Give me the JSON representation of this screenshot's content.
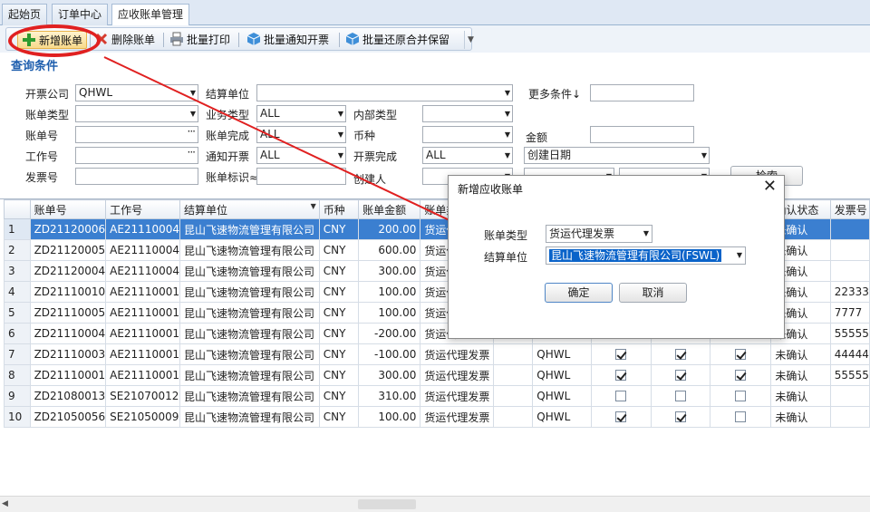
{
  "tabs": [
    {
      "label": "起始页"
    },
    {
      "label": "订单中心"
    },
    {
      "label": "应收账单管理"
    }
  ],
  "toolbar": {
    "new_bill": "新增账单",
    "delete_bill": "删除账单",
    "batch_print": "批量打印",
    "batch_notify_invoice": "批量通知开票",
    "batch_restore_merge": "批量还原合并保留"
  },
  "query": {
    "title": "查询条件",
    "invoice_company_label": "开票公司",
    "invoice_company_value": "QHWL",
    "settle_unit_label": "结算单位",
    "more_conditions_label": "更多条件↓",
    "bill_type_label": "账单类型",
    "business_type_label": "业务类型",
    "business_type_value": "ALL",
    "internal_type_label": "内部类型",
    "bill_no_label": "账单号",
    "bill_complete_label": "账单完成",
    "bill_complete_value": "ALL",
    "currency_label": "币种",
    "amount_label": "金额",
    "job_no_label": "工作号",
    "notify_invoice_label": "通知开票",
    "notify_invoice_value": "ALL",
    "invoice_complete_label": "开票完成",
    "invoice_complete_value": "ALL",
    "date_type_value": "创建日期",
    "invoice_no_label": "发票号",
    "bill_mark_label": "账单标识≈",
    "creator_label": "创建人",
    "search_button": "检索"
  },
  "grid": {
    "headers": [
      "",
      "账单号",
      "工作号",
      "结算单位",
      "币种",
      "账单金额",
      "账单类",
      "",
      "",
      "",
      "",
      "",
      "确认状态",
      "发票号"
    ],
    "rows": [
      {
        "n": "1",
        "bill": "ZD21120006",
        "job": "AE21110004",
        "unit": "昆山飞速物流管理有限公司",
        "cur": "CNY",
        "amt": "200.00",
        "type": "货运代",
        "co": "",
        "c1": null,
        "c2": null,
        "c3": null,
        "status": "未确认",
        "inv": ""
      },
      {
        "n": "2",
        "bill": "ZD21120005",
        "job": "AE21110004",
        "unit": "昆山飞速物流管理有限公司",
        "cur": "CNY",
        "amt": "600.00",
        "type": "货运代",
        "co": "",
        "c1": null,
        "c2": null,
        "c3": null,
        "status": "未确认",
        "inv": ""
      },
      {
        "n": "3",
        "bill": "ZD21120004",
        "job": "AE21110004",
        "unit": "昆山飞速物流管理有限公司",
        "cur": "CNY",
        "amt": "300.00",
        "type": "货运代",
        "co": "",
        "c1": null,
        "c2": null,
        "c3": null,
        "status": "未确认",
        "inv": ""
      },
      {
        "n": "4",
        "bill": "ZD21110010",
        "job": "AE21110001",
        "unit": "昆山飞速物流管理有限公司",
        "cur": "CNY",
        "amt": "100.00",
        "type": "货运代",
        "co": "",
        "c1": null,
        "c2": null,
        "c3": null,
        "status": "未确认",
        "inv": "22333"
      },
      {
        "n": "5",
        "bill": "ZD21110005",
        "job": "AE21110001",
        "unit": "昆山飞速物流管理有限公司",
        "cur": "CNY",
        "amt": "100.00",
        "type": "货运代",
        "co": "",
        "c1": null,
        "c2": null,
        "c3": null,
        "status": "未确认",
        "inv": "7777"
      },
      {
        "n": "6",
        "bill": "ZD21110004",
        "job": "AE21110001",
        "unit": "昆山飞速物流管理有限公司",
        "cur": "CNY",
        "amt": "-200.00",
        "type": "货运代",
        "co": "",
        "c1": null,
        "c2": null,
        "c3": null,
        "status": "未确认",
        "inv": "55555"
      },
      {
        "n": "7",
        "bill": "ZD21110003",
        "job": "AE21110001",
        "unit": "昆山飞速物流管理有限公司",
        "cur": "CNY",
        "amt": "-100.00",
        "type": "货运代理发票",
        "co": "QHWL",
        "c1": true,
        "c2": true,
        "c3": true,
        "status": "未确认",
        "inv": "44444"
      },
      {
        "n": "8",
        "bill": "ZD21110001",
        "job": "AE21110001",
        "unit": "昆山飞速物流管理有限公司",
        "cur": "CNY",
        "amt": "300.00",
        "type": "货运代理发票",
        "co": "QHWL",
        "c1": true,
        "c2": true,
        "c3": true,
        "status": "未确认",
        "inv": "55555"
      },
      {
        "n": "9",
        "bill": "ZD21080013",
        "job": "SE21070012",
        "unit": "昆山飞速物流管理有限公司",
        "cur": "CNY",
        "amt": "310.00",
        "type": "货运代理发票",
        "co": "QHWL",
        "c1": false,
        "c2": false,
        "c3": false,
        "status": "未确认",
        "inv": ""
      },
      {
        "n": "10",
        "bill": "ZD21050056",
        "job": "SE21050009",
        "unit": "昆山飞速物流管理有限公司",
        "cur": "CNY",
        "amt": "100.00",
        "type": "货运代理发票",
        "co": "QHWL",
        "c1": true,
        "c2": true,
        "c3": false,
        "status": "未确认",
        "inv": ""
      }
    ]
  },
  "dialog": {
    "title": "新增应收账单",
    "bill_type_label": "账单类型",
    "bill_type_value": "货运代理发票",
    "settle_unit_label": "结算单位",
    "settle_unit_value": "昆山飞速物流管理有限公司(FSWL)",
    "ok": "确定",
    "cancel": "取消"
  },
  "colors": {
    "accent_red": "#e02020",
    "selection_blue": "#3b7fd0",
    "title_blue": "#1f5fae"
  }
}
